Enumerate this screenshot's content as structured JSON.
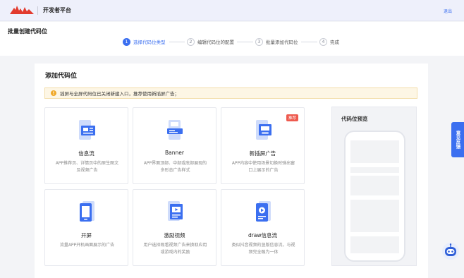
{
  "header": {
    "brand": "开发者平台",
    "logout": "退出"
  },
  "stepbar": {
    "title": "批量创建代码位",
    "steps": [
      {
        "num": "1",
        "label": "选择代码位类型"
      },
      {
        "num": "2",
        "label": "编辑代码位的配置"
      },
      {
        "num": "3",
        "label": "批量添加代码位"
      },
      {
        "num": "4",
        "label": "完成"
      }
    ]
  },
  "panel": {
    "title": "添加代码位",
    "notice": "插屏与全屏代码位已关闭新建入口，推荐使用新插屏广告；",
    "cards": [
      {
        "title": "信息流",
        "desc": "APP推荐页、详情页中的原生图文及视频广告",
        "icon": "feed-ad-icon"
      },
      {
        "title": "Banner",
        "desc": "APP界面顶部、中部或底部展现的多形态广告样式",
        "icon": "banner-ad-icon"
      },
      {
        "title": "新插屏广告",
        "desc": "APP内容中使用场景切换时弹出窗口上展示的广告",
        "icon": "interstitial-ad-icon",
        "badge": "推荐"
      },
      {
        "title": "开屏",
        "desc": "流量APP开机画面展示的广告",
        "icon": "splash-ad-icon"
      },
      {
        "title": "激励视频",
        "desc": "用户选择观看视频广告来换取应用或游戏内的奖励",
        "icon": "rewarded-video-icon"
      },
      {
        "title": "draw信息流",
        "desc": "类似抖音视频的竖版信息流，与视频完全融为一体",
        "icon": "draw-feed-icon"
      }
    ],
    "preview_title": "代码位预览"
  },
  "feedback": "意见反馈",
  "colors": {
    "accent": "#3b6ff0",
    "badge": "#ee5a4e",
    "notice_bg": "#fdf6e5",
    "logo": "#e23b2e"
  }
}
